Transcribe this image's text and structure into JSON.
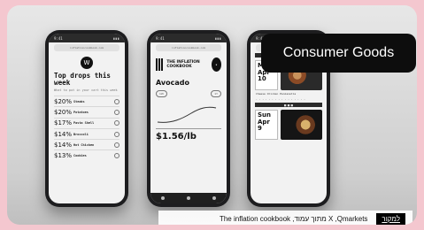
{
  "overlay": {
    "title": "Consumer Goods"
  },
  "caption": {
    "text": "The inflation cookbook ,מתוך עמוד X ,Qmarkets",
    "link_label": "למקור"
  },
  "phone1": {
    "header": "Top drops this week",
    "sub": "What to put in your cart this week",
    "rows": [
      {
        "price": "$20%",
        "name": "Steaks"
      },
      {
        "price": "$20%",
        "name": "Potatoes"
      },
      {
        "price": "$17%",
        "name": "Pasta Shell"
      },
      {
        "price": "$14%",
        "name": "Broccoli"
      },
      {
        "price": "$14%",
        "name": "Hot Chicken"
      },
      {
        "price": "$13%",
        "name": "Cookies"
      }
    ]
  },
  "phone2": {
    "brand": "THE INFLATION COOKBOOK",
    "item": "Avocado",
    "price": "$1.56/lb"
  },
  "phone3": {
    "days": [
      {
        "label": "Mon Apr 10"
      },
      {
        "label": "Sun Apr 9"
      }
    ],
    "recipe": "Cheese Chicken Panzanella"
  }
}
